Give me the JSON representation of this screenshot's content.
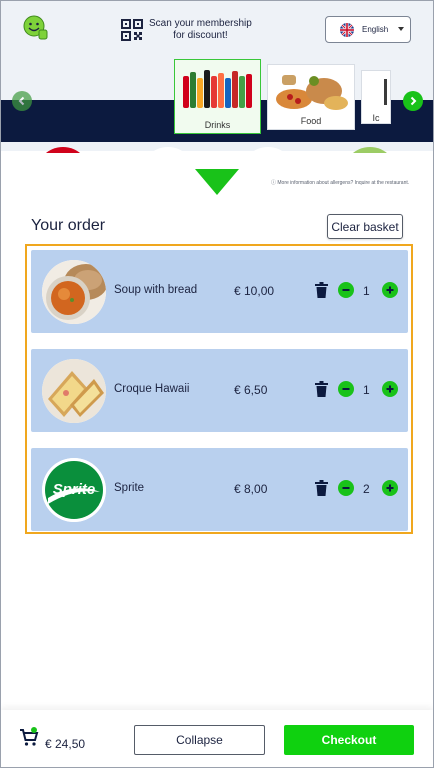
{
  "header": {
    "membership_text_line1": "Scan your membership",
    "membership_text_line2": "for discount!",
    "language": "English",
    "categories": [
      {
        "label": "Drinks"
      },
      {
        "label": "Food"
      },
      {
        "label": "Ic"
      }
    ]
  },
  "info": {
    "allergen_text": "More information about allergens? Inquire at the restaurant."
  },
  "order": {
    "title": "Your order",
    "clear_label": "Clear basket",
    "items": [
      {
        "name": "Soup with bread",
        "price": "€ 10,00",
        "qty": "1"
      },
      {
        "name": "Croque Hawaii",
        "price": "€ 6,50",
        "qty": "1"
      },
      {
        "name": "Sprite",
        "price": "€ 8,00",
        "qty": "2"
      }
    ]
  },
  "footer": {
    "total": "€ 24,50",
    "collapse_label": "Collapse",
    "checkout_label": "Checkout"
  },
  "colors": {
    "accent_green": "#19c219",
    "navy": "#0c1a3f",
    "row_blue": "#b9d0ee",
    "highlight_orange": "#f0a71e"
  },
  "icons": [
    "logo-icon",
    "qr-code-icon",
    "uk-flag-icon",
    "chevron-down-icon",
    "arrow-left-icon",
    "arrow-right-icon",
    "info-icon",
    "trash-icon",
    "minus-icon",
    "plus-icon",
    "cart-icon"
  ]
}
